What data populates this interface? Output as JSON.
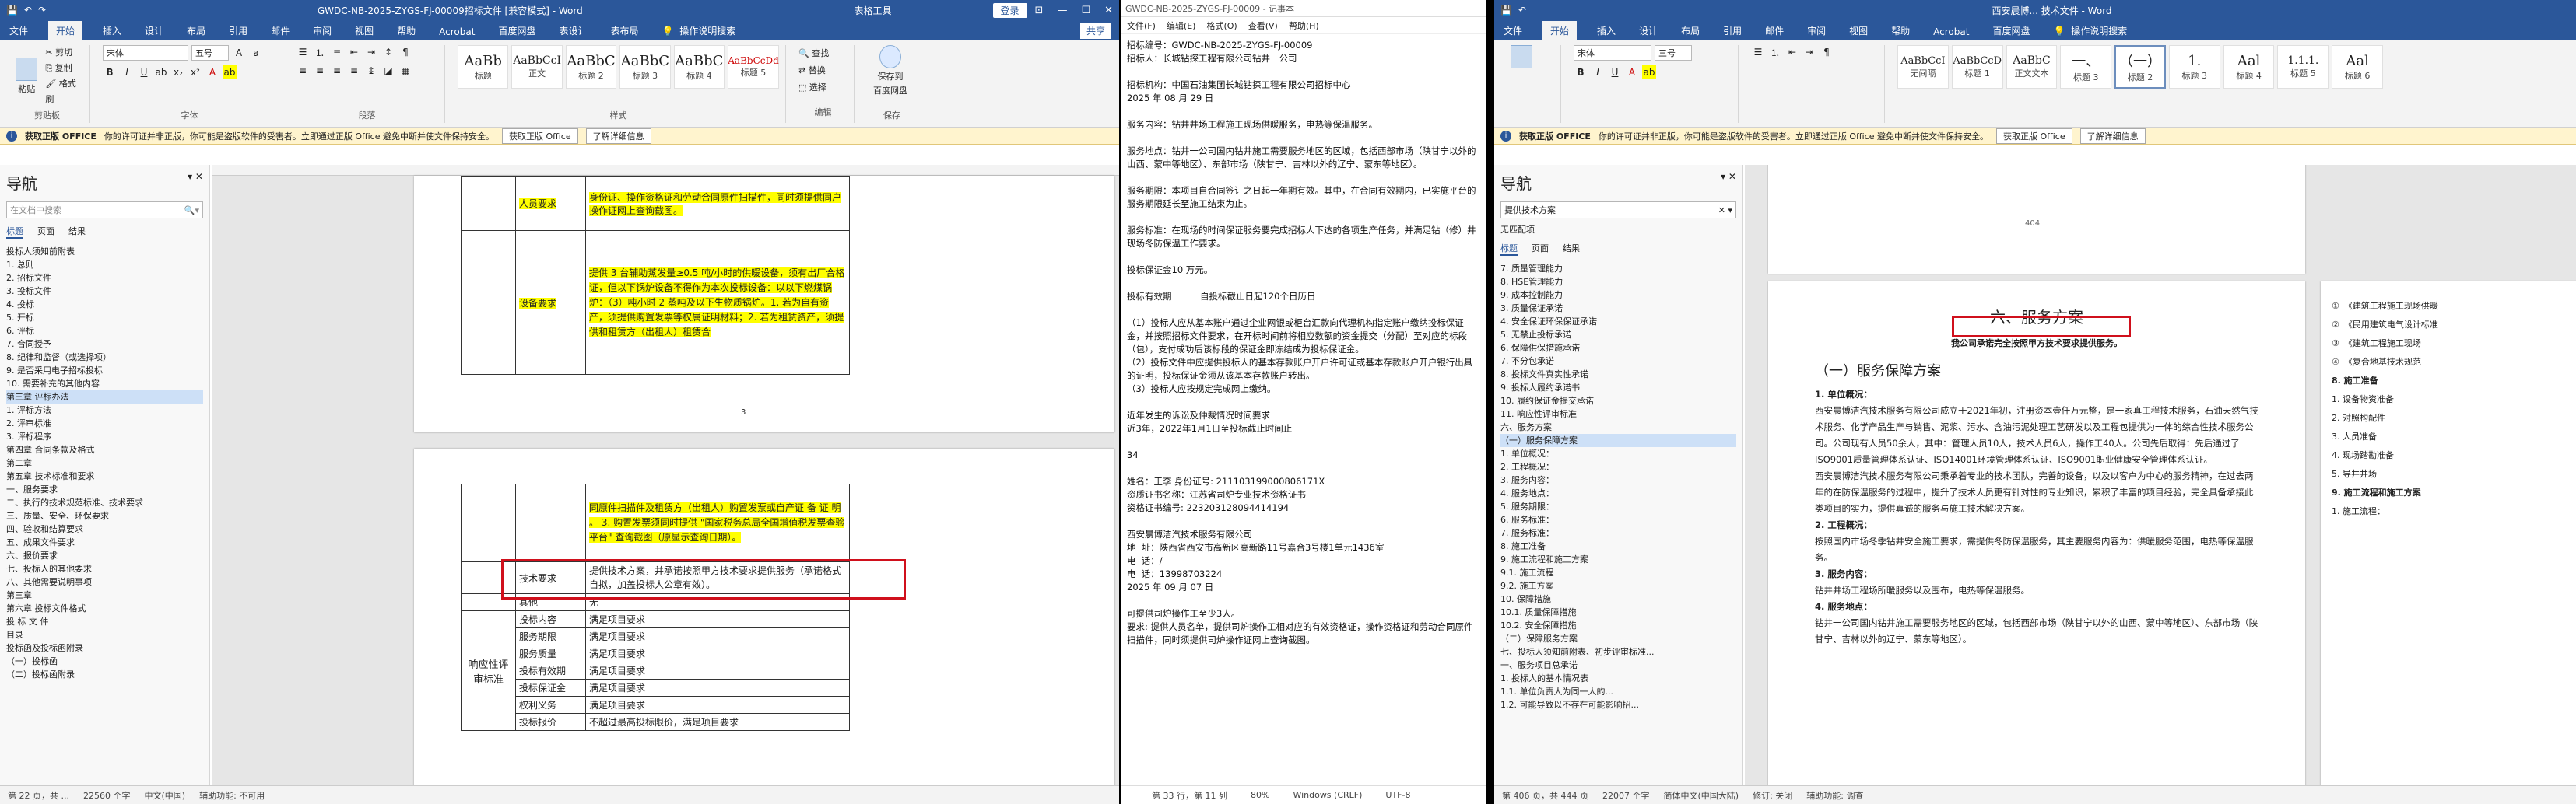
{
  "winA": {
    "title": "GWDC-NB-2025-ZYGS-FJ-00009招标文件 [兼容模式] - Word",
    "context_tab": "表格工具",
    "login": "登录",
    "win_controls": [
      "⊡",
      "—",
      "☐",
      "✕"
    ],
    "tabs": [
      "文件",
      "开始",
      "插入",
      "设计",
      "布局",
      "引用",
      "邮件",
      "审阅",
      "视图",
      "帮助",
      "Acrobat",
      "百度网盘",
      "表设计",
      "表布局"
    ],
    "tell_me": "操作说明搜索",
    "share": "共享",
    "clipboard": {
      "paste": "粘贴",
      "cut": "剪切",
      "copy": "复制",
      "painter": "格式刷",
      "label": "剪贴板"
    },
    "font": {
      "name": "宋体",
      "size": "五号",
      "label": "字体"
    },
    "para_label": "段落",
    "styles": [
      {
        "sample": "AaBb",
        "name": "标题"
      },
      {
        "sample": "AaBbCcI",
        "name": "正文"
      },
      {
        "sample": "AaBbC",
        "name": "标题 2"
      },
      {
        "sample": "AaBbC",
        "name": "标题 3"
      },
      {
        "sample": "AaBbC",
        "name": "标题 4"
      },
      {
        "sample": "AaBbCcDd",
        "name": "标题 5"
      }
    ],
    "styles_label": "样式",
    "editing": {
      "find": "查找",
      "replace": "替换",
      "select": "选择",
      "label": "编辑"
    },
    "save_cloud": {
      "l1": "保存到",
      "l2": "百度网盘",
      "label": "保存"
    },
    "infobar": {
      "tag": "获取正版 OFFICE",
      "msg": "你的许可证并非正版，你可能是盗版软件的受害者。立即通过正版 Office 避免中断并使文件保持安全。",
      "btn1": "获取正版 Office",
      "btn2": "了解详细信息"
    },
    "nav": {
      "title": "导航",
      "search_placeholder": "在文档中搜索",
      "tabs": [
        "标题",
        "页面",
        "结果"
      ],
      "items": [
        "投标人须知前附表",
        "1. 总则",
        "2. 招标文件",
        "3. 投标文件",
        "4. 投标",
        "5. 开标",
        "6. 评标",
        "7. 合同授予",
        "8. 纪律和监督（或选择项）",
        "9. 是否采用电子招标投标",
        "10. 需要补充的其他内容",
        "第三章 评标办法",
        "1. 评标方法",
        "2. 评审标准",
        "3. 评标程序",
        "第四章 合同条款及格式",
        "第二章",
        "第五章 技术标准和要求",
        "一、服务要求",
        "二、执行的技术规范标准、技术要求",
        "三、质量、安全、环保要求",
        "四、验收和结算要求",
        "五、成果文件要求",
        "六、报价要求",
        "七、投标人的其他要求",
        "八、其他需要说明事项",
        "第三章",
        "第六章 投标文件格式",
        "投 标 文 件",
        "目录",
        "投标函及投标函附录",
        "（一）投标函",
        "（二）投标函附录"
      ],
      "selected_index": 11
    },
    "table1": [
      {
        "label": "人员要求",
        "text": "身份证、操作资格证和劳动合同原件扫描件，同时须提供同户操作证网上查询截图。"
      },
      {
        "label": "设备要求",
        "text": "提供 3 台辅助蒸发量≥0.5 吨/小时的供暖设备，须有出厂合格证，但以下锅炉设备不得作为本次投标设备：以以下燃煤锅炉：（3）吨小时 2 蒸吨及以下生物质锅炉。1. 若为自有资产，须提供购置发票等权属证明材料；2. 若为租赁资产，须提供和租赁方（出租人）租赁合"
      }
    ],
    "table2": {
      "top_text": "同原件扫描件及租赁方（出租人）购置发票或自产证 备 证 明 。 3. 购置发票须同时提供 \"国家税务总局全国增值税发票查验平台\" 查询截图（原显示查询日期）。",
      "tech_label": "技术要求",
      "tech_text": "提供技术方案，并承诺按照甲方技术要求提供服务（承诺格式自拟，加盖投标人公章有效）。",
      "other_label": "其他",
      "other_text": "无",
      "group_label": "响应性评审标准",
      "rows": [
        {
          "label": "投标内容",
          "text": "满足项目要求"
        },
        {
          "label": "服务期限",
          "text": "满足项目要求"
        },
        {
          "label": "服务质量",
          "text": "满足项目要求"
        },
        {
          "label": "投标有效期",
          "text": "满足项目要求"
        },
        {
          "label": "投标保证金",
          "text": "满足项目要求"
        },
        {
          "label": "权利义务",
          "text": "满足项目要求"
        },
        {
          "label": "投标报价",
          "text": "不超过最高投标限价，满足项目要求"
        }
      ],
      "page_no": "3"
    },
    "status": {
      "page": "第 22 页，共 ...",
      "words": "22560 个字",
      "lang": "中文(中国)",
      "a11y": "辅助功能: 不可用"
    }
  },
  "winB": {
    "filename": "GWDC-NB-2025-ZYGS-FJ-00009 - 记事本",
    "menu": [
      "文件(F)",
      "编辑(E)",
      "格式(O)",
      "查看(V)",
      "帮助(H)"
    ],
    "lines": [
      "招标编号：GWDC-NB-2025-ZYGS-FJ-00009",
      "招标人：长城钻探工程有限公司钻井一公司",
      "",
      "招标机构：中国石油集团长城钻探工程有限公司招标中心",
      "2025 年 08 月 29 日",
      "",
      "服务内容：钻井井场工程施工现场供暖服务，电热等保温服务。",
      "",
      "服务地点：钻井一公司国内钻井施工需要服务地区的区域，包括西部市场（陕甘宁以外的山西、蒙中等地区）、东部市场（陕甘宁、吉林以外的辽宁、蒙东等地区）。",
      "",
      "服务期限：本项目自合同签订之日起一年期有效。其中，在合同有效期内，已实施平台的服务期限延长至施工结束为止。",
      "",
      "服务标准：在现场的时间保证服务要完成招标人下达的各项生产任务，并满足钻（修）井现场冬防保温工作要求。",
      "",
      "投标保证金10 万元。",
      "",
      "投标有效期          自投标截止日起120个日历日",
      "",
      "（1）投标人应从基本账户通过企业网银或柜台汇款向代理机构指定账户缴纳投标保证金，并按照招标文件要求，在开标时间前将相应数额的资金提交（分配）至对应的标段（包），支付成功后该标段的保证金即冻结成为投标保证金。",
      "（2）投标文件中应提供投标人的基本存款账户开户许可证或基本存款账户开户银行出具的证明，投标保证金须从该基本存款账户转出。",
      "（3）投标人应按规定完成网上缴纳。",
      "",
      "近年发生的诉讼及仲裁情况时间要求",
      "近3年，2022年1月1日至投标截止时间止",
      "",
      "34",
      "",
      "姓名：王李 身份证号: 211103199000806171X",
      "资质证书名称：江苏省司炉专业技术资格证书",
      "资格证书编号: 223203128094414194",
      "",
      "西安晨博洁汽技术服务有限公司",
      "地  址：陕西省西安市高新区高新路11号嘉合3号楼1单元1436室",
      "电  话：/",
      "电  话：13998703224",
      "2025 年 09 月 07 日",
      "",
      "可提供司炉操作工至少3人。",
      "要求: 提供人员名单，提供司炉操作工相对应的有效资格证，操作资格证和劳动合同原件扫描件，同时须提供司炉操作证网上查询截图。"
    ],
    "status": {
      "pos": "第 33 行，第 11 列",
      "zoom": "80%",
      "eol": "Windows (CRLF)",
      "enc": "UTF-8"
    }
  },
  "winC": {
    "title": "西安晨博... 技术文件 - Word",
    "tabs": [
      "文件",
      "开始",
      "插入",
      "设计",
      "布局",
      "引用",
      "邮件",
      "审阅",
      "视图",
      "帮助",
      "Acrobat",
      "百度网盘"
    ],
    "tell_me": "操作说明搜索",
    "font": {
      "name": "宋体",
      "size": "三号"
    },
    "styles": [
      {
        "sample": "AaBbCcI",
        "name": "无间隔"
      },
      {
        "sample": "AaBbCcD",
        "name": "标题 1"
      },
      {
        "sample": "AaBbC",
        "name": "正文文本"
      },
      {
        "sample": "一、",
        "name": "标题 3"
      },
      {
        "sample": "（一）",
        "name": "标题 2"
      },
      {
        "sample": "1.",
        "name": "标题 3"
      },
      {
        "sample": "Aal",
        "name": "标题 4"
      },
      {
        "sample": "1.1.1.",
        "name": "标题 5"
      },
      {
        "sample": "Aal",
        "name": "标题 6"
      }
    ],
    "infobar": {
      "tag": "获取正版 OFFICE",
      "msg": "你的许可证并非正版，你可能是盗版软件的受害者。立即通过正版 Office 避免中断并使文件保持安全。",
      "btn1": "获取正版 Office",
      "btn2": "了解详细信息"
    },
    "nav": {
      "title": "导航",
      "search_value": "提供技术方案",
      "no_match": "无匹配项",
      "tabs": [
        "标题",
        "页面",
        "结果"
      ],
      "items": [
        "7. 质量管理能力",
        "8. HSE管理能力",
        "9. 成本控制能力",
        "3. 质量保证承诺",
        "4. 安全保证环保保证承诺",
        "5. 无禁止投标承诺",
        "6. 保障供保措施承诺",
        "7. 不分包承诺",
        "8. 投标文件真实性承诺",
        "9. 投标人履约承诺书",
        "10. 履约保证金提交承诺",
        "11. 响应性评审标准",
        "六、服务方案",
        "（一）服务保障方案",
        "1. 单位概况：",
        "2. 工程概况：",
        "3. 服务内容：",
        "4. 服务地点：",
        "5. 服务期限：",
        "6. 服务标准：",
        "7. 服务标准：",
        "8. 施工准备",
        "9. 施工流程和施工方案",
        "9.1. 施工流程",
        "9.2. 施工方案",
        "10. 保障措施",
        "10.1. 质量保障措施",
        "10.2. 安全保障措施",
        "（二）保障服务方案",
        "七、投标人须知前附表、初步评审标准...",
        "一、服务项目总承诺",
        "1. 投标人的基本情况表",
        "1.1. 单位负责人为同一人的... ",
        "1.2. 可能导致以不存在可能影响招..."
      ],
      "selected_index": 13
    },
    "page_top_no": "404",
    "section_title": "六、服务方案",
    "commit_text": "我公司承诺完全按照甲方技术要求提供服务。",
    "sub_title": "（一）服务保障方案",
    "h1": "1. 单位概况：",
    "p1": "西安晨博洁汽技术服务有限公司成立于2021年初，注册资本壹仟万元整，是一家真工程技术服务，石油天然气技术服务、化学产品生产与销售、泥浆、污水、含油污泥处理工艺研发以及工程包提供为一体的综合性技术服务公司。公司现有人员50余人，其中：管理人员10人，技术人员6人，操作工40人。公司先后取得：先后通过了ISO9001质量管理体系认证、ISO14001环境管理体系认证、ISO9001职业健康安全管理体系认证。",
    "p2": "西安晨博洁汽技术服务有限公司秉承着专业的技术团队，完善的设备，以及以客户为中心的服务精神，在过去两年的在防保温服务的过程中，提升了技术人员更有针对性的专业知识，累积了丰富的项目经验，完全具备承接此类项目的实力，提供真诚的服务与施工技术解决方案。",
    "h2": "2. 工程概况：",
    "p3": "按照国内市场冬季钻井安全施工要求，需提供冬防保温服务，其主要服务内容为：供暖服务范围，电热等保温服务。",
    "h3": "3. 服务内容：",
    "p4": "钻井井场工程场所暖服务以及围布，电热等保温服务。",
    "h4": "4. 服务地点：",
    "p5": "钻井一公司国内钻井施工需要服务地区的区域，包括西部市场（陕甘宁以外的山西、蒙中等地区）、东部市场（陕甘宁、吉林以外的辽宁、蒙东等地区）。",
    "right_col": [
      "①",
      "②",
      "③",
      "④",
      "8. 施工准备",
      "1. 设备物资准备",
      "2. 对照构配件",
      "3. 人员准备",
      "4. 现场踏勘准备",
      "5. 导井井场",
      "9. 施工流程和施工方案",
      "1. 施工流程："
    ],
    "right_col_text": [
      "《建筑工程施工现场供暖",
      "《民用建筑电气设计标准",
      "《建筑工程施工现场",
      "《复合地基技术规范"
    ],
    "status": {
      "page": "第 406 页，共 444 页",
      "words": "22007 个字",
      "lang": "简体中文(中国大陆)",
      "mode": "辅助功能: 调查",
      "track": "修订: 关闭"
    }
  }
}
